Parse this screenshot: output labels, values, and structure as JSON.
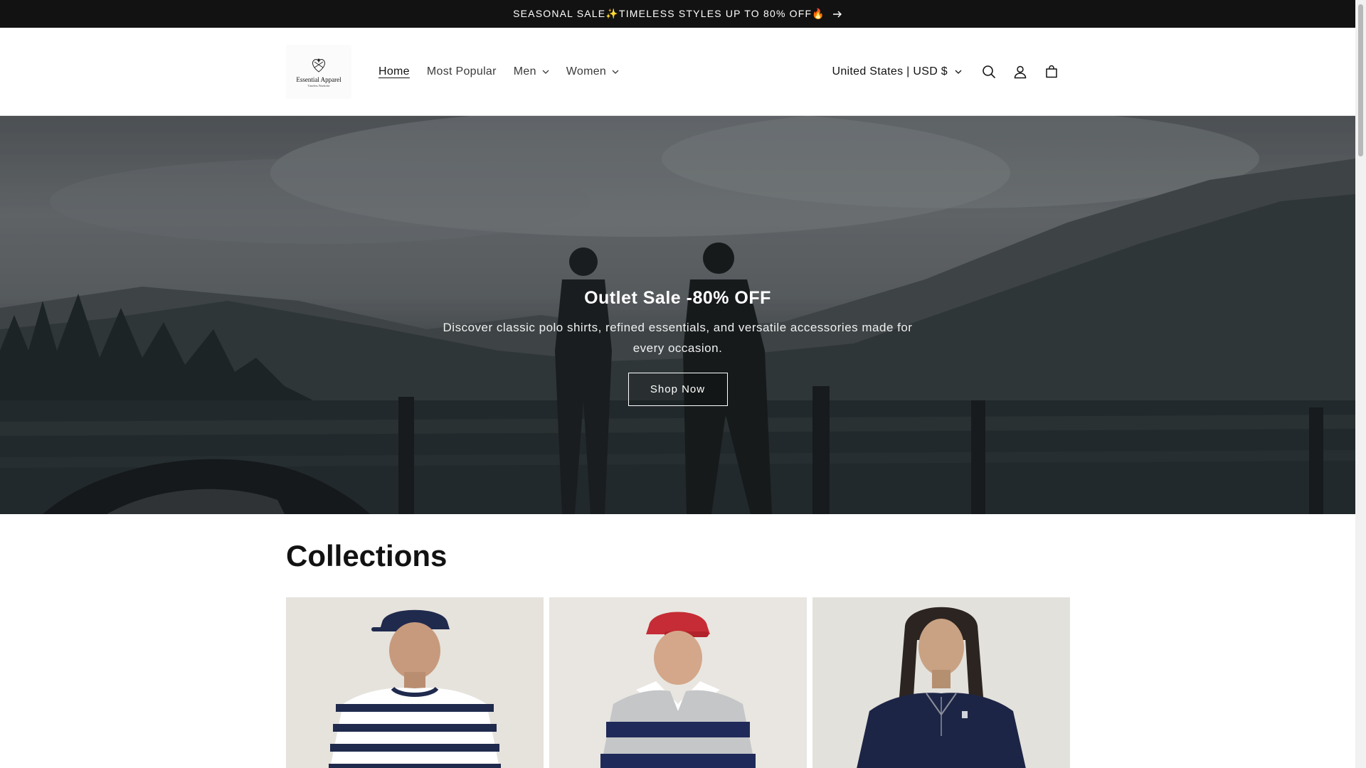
{
  "announcement": {
    "text": "SEASONAL SALE✨TIMELESS STYLES UP TO 80% OFF🔥",
    "arrow_icon": "arrow-right-icon"
  },
  "header": {
    "logo": {
      "name": "Essential Apparel",
      "tagline": "Timeless Wardrobe"
    },
    "nav": [
      {
        "label": "Home",
        "active": true
      },
      {
        "label": "Most Popular"
      },
      {
        "label": "Men",
        "dropdown": true
      },
      {
        "label": "Women",
        "dropdown": true
      }
    ],
    "locale": "United States | USD $",
    "icons": [
      "search-icon",
      "account-icon",
      "cart-icon"
    ]
  },
  "hero": {
    "title": "Outlet Sale -80% OFF",
    "text": "Discover classic polo shirts, refined essentials, and versatile accessories made for every occasion.",
    "button": "Shop Now"
  },
  "collections": {
    "title": "Collections",
    "cards": [
      {
        "image": "striped-tee-model",
        "accent": "#1f2a4d"
      },
      {
        "image": "rugby-shirt-model",
        "accent": "#c62c35"
      },
      {
        "image": "navy-pullover-model",
        "accent": "#1d2546"
      }
    ]
  }
}
